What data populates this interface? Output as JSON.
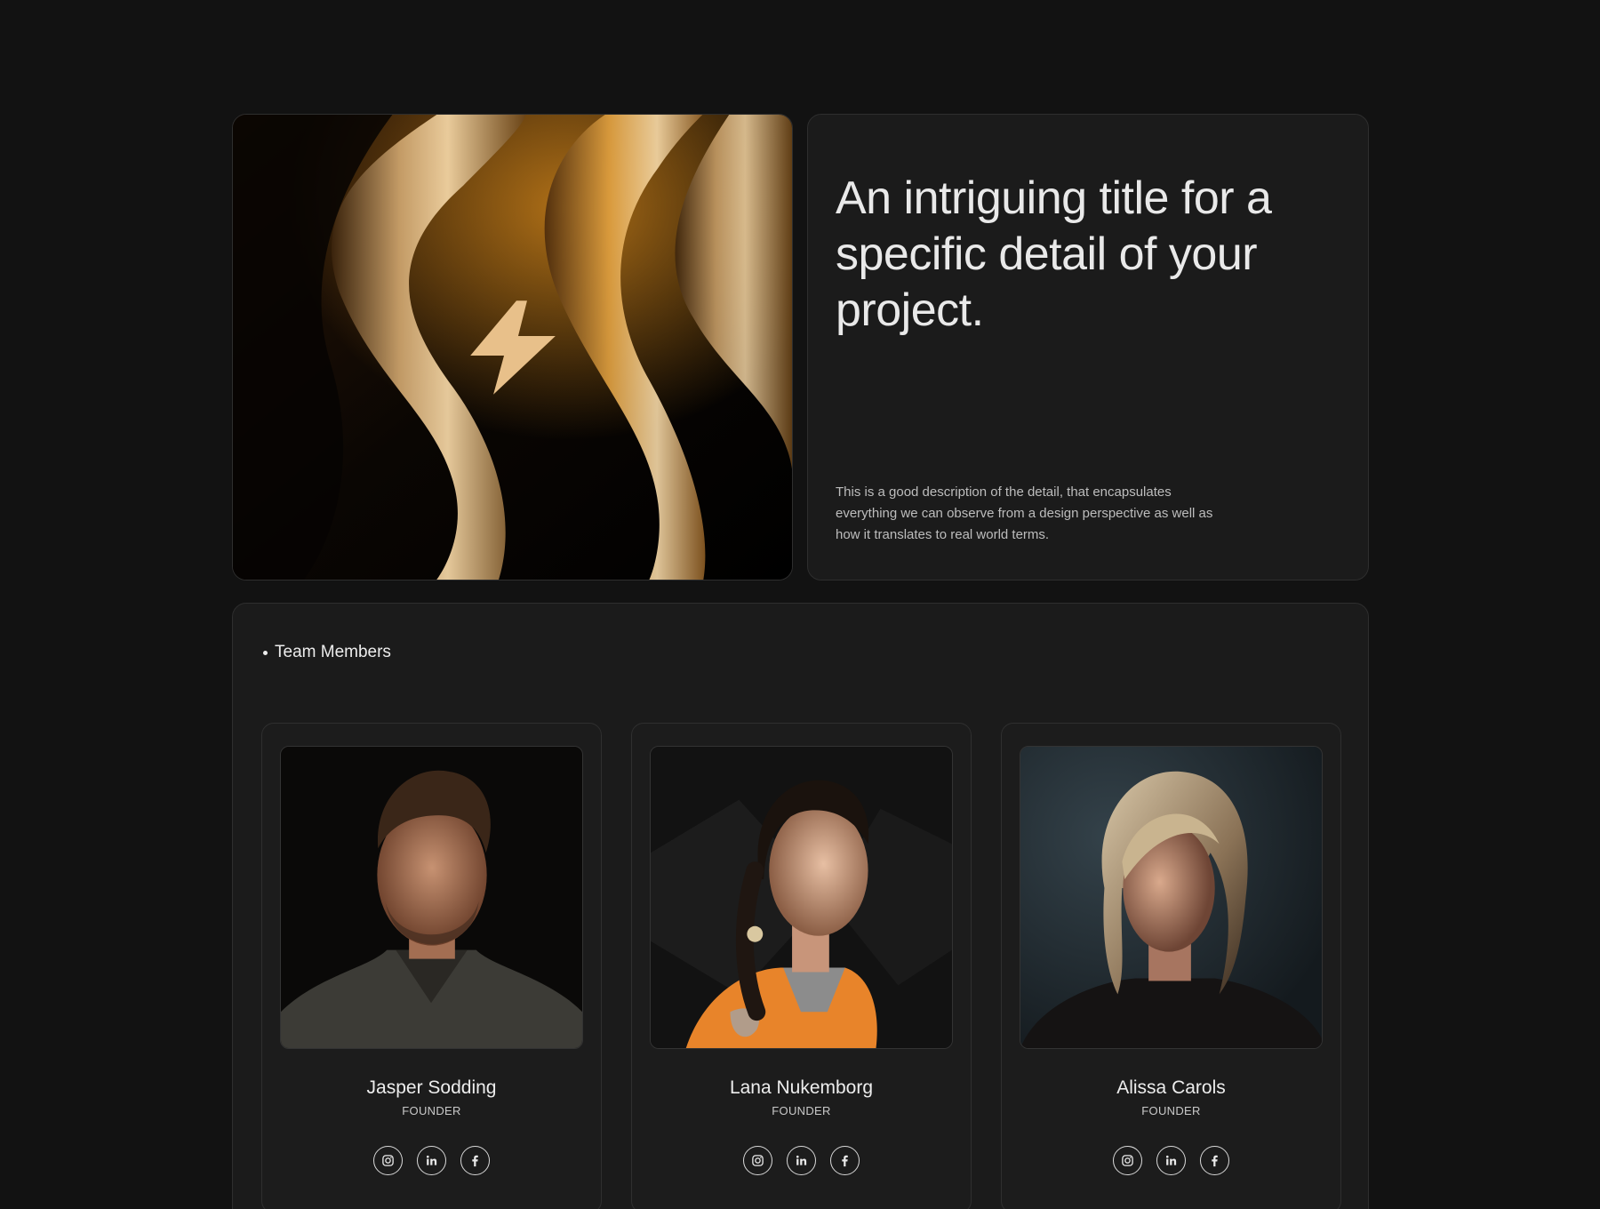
{
  "hero": {
    "image_description_icon": "lightning-bolt-icon",
    "accent_color": "#e8c08a"
  },
  "detail": {
    "title": "An intriguing title for a specific detail of your project.",
    "description": "This is a good description of the detail, that encapsulates everything we can observe from a design perspective as well as how it translates to real world terms."
  },
  "team": {
    "heading": "Team Members",
    "members": [
      {
        "name": "Jasper Sodding",
        "role": "FOUNDER",
        "socials": [
          "instagram-icon",
          "linkedin-icon",
          "facebook-icon"
        ]
      },
      {
        "name": "Lana Nukemborg",
        "role": "FOUNDER",
        "socials": [
          "instagram-icon",
          "linkedin-icon",
          "facebook-icon"
        ]
      },
      {
        "name": "Alissa Carols",
        "role": "FOUNDER",
        "socials": [
          "instagram-icon",
          "linkedin-icon",
          "facebook-icon"
        ]
      }
    ]
  }
}
